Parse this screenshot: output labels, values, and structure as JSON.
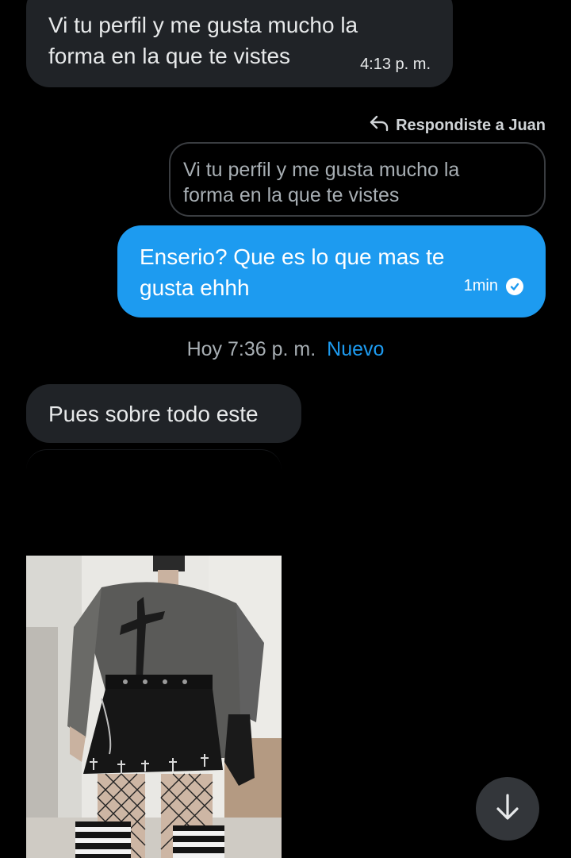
{
  "messages": {
    "incoming_1": {
      "lines": [
        "Vi tu perfil y me gusta mucho la",
        "forma en la que te vistes"
      ],
      "time": "4:13 p. m."
    },
    "reply_context": {
      "label": "Respondiste a Juan",
      "icon": "reply-arrow-icon",
      "quoted_lines": [
        "Vi tu perfil y me gusta mucho la",
        "forma en la que te vistes"
      ]
    },
    "outgoing_1": {
      "lines": [
        "Enserio? Que es lo que mas te",
        "gusta ehhh"
      ],
      "time": "1min",
      "status_icon": "read-check-icon"
    },
    "divider": {
      "date_time": "Hoy 7:36 p. m.",
      "new_label": "Nuevo"
    },
    "incoming_2": {
      "text": "Pues sobre todo este"
    },
    "incoming_photo": {
      "icon": "photo-outfit"
    }
  },
  "controls": {
    "scroll_to_bottom_icon": "arrow-down-icon"
  },
  "colors": {
    "background": "#000000",
    "incoming_bubble": "#202327",
    "outgoing_bubble": "#1d9bf0",
    "accent": "#1d9bf0",
    "muted_text": "#a7aeb3"
  }
}
